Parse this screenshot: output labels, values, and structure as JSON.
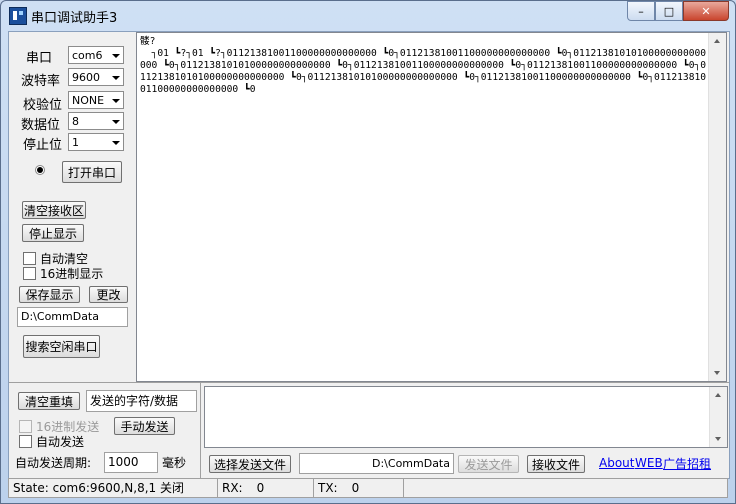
{
  "window": {
    "title": "串口调试助手3"
  },
  "left": {
    "port_label": "串口",
    "port_value": "com6",
    "baud_label": "波特率",
    "baud_value": "9600",
    "parity_label": "校验位",
    "parity_value": "NONE",
    "databits_label": "数据位",
    "databits_value": "8",
    "stopbits_label": "停止位",
    "stopbits_value": "1",
    "open_port": "打开串口",
    "clear_recv": "清空接收区",
    "stop_display": "停止显示",
    "auto_clear": "自动清空",
    "hex_display": "16进制显示",
    "save_display": "保存显示",
    "change": "更改",
    "path": "D:\\CommData",
    "search_port": "搜索空闲串口"
  },
  "receive": {
    "text": "髅?\n  ┐01 ┗?┐01 ┗?┐01121381001100000000000000 ┗0┐01121381001100000000000000 ┗0┐01121381010100000000000000 ┗0┐01121381010100000000000000 ┗0┐01121381001100000000000000 ┗0┐01121381001100000000000000 ┗0┐01121381010100000000000000 ┗0┐01121381010100000000000000 ┗0┐01121381001100000000000000 ┗0┐01121381001100000000000000 ┗0"
  },
  "send": {
    "clear_resend": "清空重填",
    "send_label": "发送的字符/数据",
    "hex_send": "16进制发送",
    "manual_send": "手动发送",
    "auto_send": "自动发送",
    "period_label": "自动发送周期:",
    "period_value": "1000",
    "period_unit": "毫秒",
    "choose_file": "选择发送文件",
    "file_path": "D:\\CommData",
    "send_file": "发送文件",
    "recv_file": "接收文件",
    "about": "About",
    "web": "WEB",
    "ad": "广告招租"
  },
  "status": {
    "state": "State: com6:9600,N,8,1 关闭",
    "rx_label": "RX:",
    "rx_value": "0",
    "tx_label": "TX:",
    "tx_value": "0"
  }
}
